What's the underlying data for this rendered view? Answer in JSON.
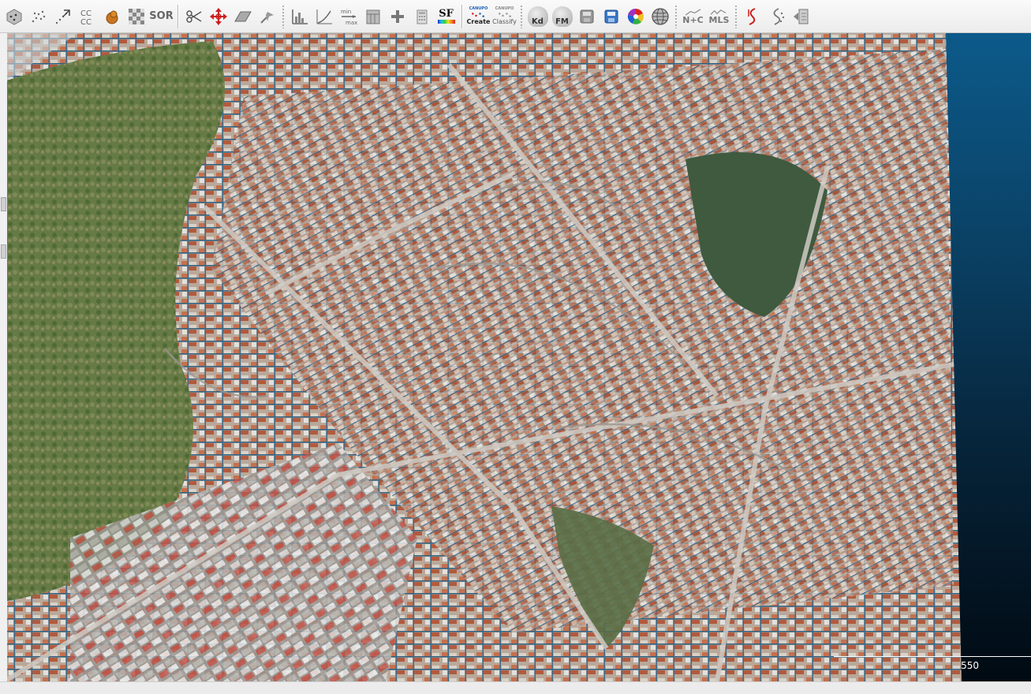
{
  "toolbar": {
    "sor_label": "SOR",
    "sf_label": "SF",
    "canupo_small": "CANUPO",
    "canupo_create": "Create",
    "canupo_classify": "Classify",
    "kd_label": "Kd",
    "fm_label": "FM",
    "ncc_label": "N+C",
    "mls_label": "MLS",
    "minmax_min": "min",
    "minmax_max": "max"
  },
  "view": {
    "scale_value": "550"
  },
  "colors": {
    "accent_red": "#cc1f1f",
    "accent_blue": "#1d5fb5",
    "bg_top": "#0c5a8a",
    "bg_bottom": "#010a12"
  }
}
